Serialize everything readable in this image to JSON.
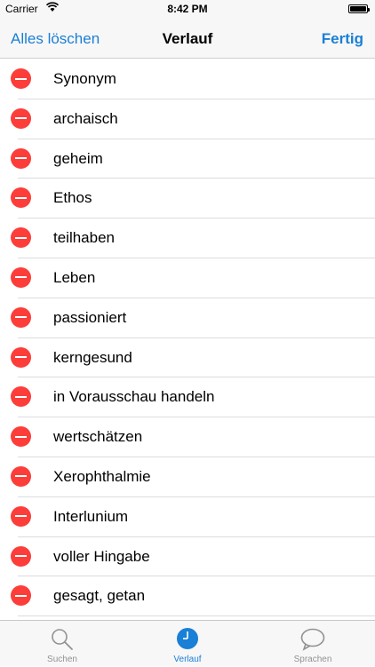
{
  "status_bar": {
    "carrier": "Carrier",
    "time": "8:42 PM"
  },
  "nav": {
    "left_button": "Alles löschen",
    "title": "Verlauf",
    "right_button": "Fertig"
  },
  "history": [
    "Synonym",
    "archaisch",
    "geheim",
    "Ethos",
    "teilhaben",
    "Leben",
    "passioniert",
    "kerngesund",
    "in Vorausschau handeln",
    "wertschätzen",
    "Xerophthalmie",
    "Interlunium",
    "voller Hingabe",
    "gesagt, getan"
  ],
  "tabs": [
    {
      "label": "Suchen",
      "icon": "magnifier-icon",
      "active": false
    },
    {
      "label": "Verlauf",
      "icon": "clock-icon",
      "active": true
    },
    {
      "label": "Sprachen",
      "icon": "speech-bubble-icon",
      "active": false
    }
  ],
  "colors": {
    "accent": "#1a7fd6",
    "delete": "#fc3d39",
    "inactive": "#929292"
  }
}
